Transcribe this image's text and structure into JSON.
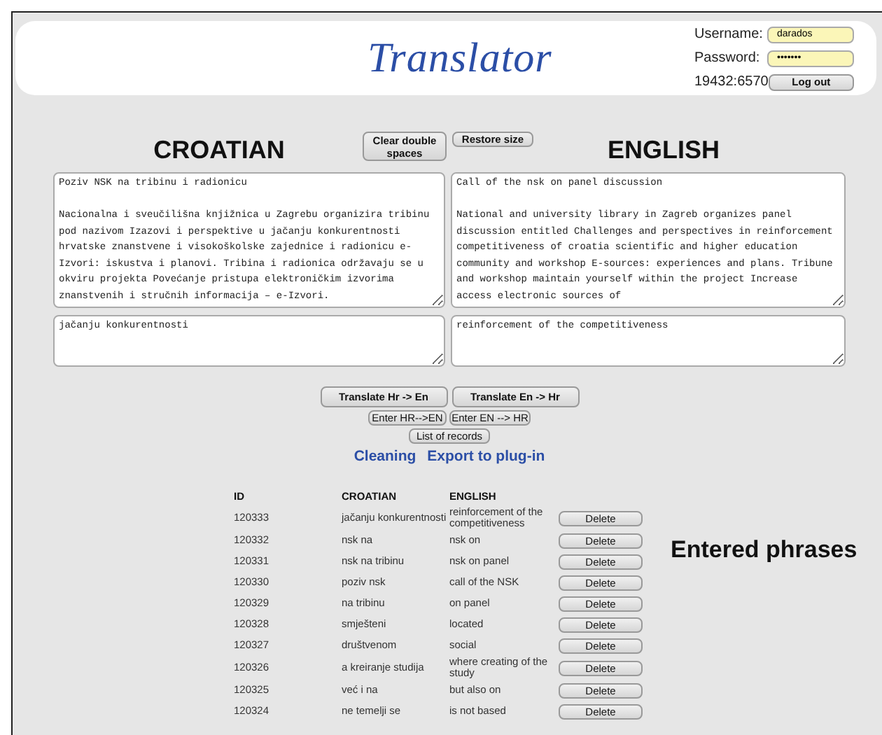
{
  "header": {
    "title": "Translator",
    "login": {
      "username_label": "Username:",
      "username": "darados",
      "password_label": "Password:",
      "password": "•••••••",
      "session": "19432:6570",
      "logout": "Log out"
    }
  },
  "languages": {
    "source_heading": "CROATIAN",
    "target_heading": "ENGLISH"
  },
  "tool_buttons": [
    "Clear double spaces",
    "Restore size"
  ],
  "source_text": "Poziv NSK na tribinu i radionicu\n\nNacionalna i sveučilišna knjižnica u Zagrebu organizira tribinu pod nazivom Izazovi i perspektive u jačanju konkurentnosti hrvatske znanstvene i visokoškolske zajednice i radionicu e-Izvori: iskustva i planovi. Tribina i radionica održavaju se u okviru projekta Povećanje pristupa elektroničkim izvorima znanstvenih i stručnih informacija – e-Izvori.",
  "target_text": "Call of the nsk on panel discussion\n\nNational and university library in Zagreb organizes panel discussion entitled Challenges and perspectives in reinforcement competitiveness of croatia scientific and higher education community and workshop E-sources: experiences and plans. Tribune and workshop maintain yourself within the project Increase access electronic sources of",
  "source_phrase": "jačanju konkurentnosti",
  "target_phrase": "reinforcement of the competitiveness",
  "translate_buttons": [
    "Translate Hr -> En",
    "Translate En -> Hr"
  ],
  "enter_buttons": [
    "Enter HR-->EN",
    "Enter EN --> HR"
  ],
  "list_button": "List of records",
  "links": [
    "Cleaning",
    "Export to plug-in"
  ],
  "records": {
    "heading": "Entered phrases",
    "columns": [
      "ID",
      "CROATIAN",
      "ENGLISH"
    ],
    "rows": [
      {
        "id": "120333",
        "croatian": "jačanju konkurentnosti",
        "english": "reinforcement of the competitiveness",
        "action": "Delete"
      },
      {
        "id": "120332",
        "croatian": "nsk na",
        "english": "nsk on",
        "action": "Delete"
      },
      {
        "id": "120331",
        "croatian": "nsk na tribinu",
        "english": "nsk on panel",
        "action": "Delete"
      },
      {
        "id": "120330",
        "croatian": "poziv nsk",
        "english": "call of the NSK",
        "action": "Delete"
      },
      {
        "id": "120329",
        "croatian": "na tribinu",
        "english": "on panel",
        "action": "Delete"
      },
      {
        "id": "120328",
        "croatian": "smješteni",
        "english": "located",
        "action": "Delete"
      },
      {
        "id": "120327",
        "croatian": "društvenom",
        "english": "social",
        "action": "Delete"
      },
      {
        "id": "120326",
        "croatian": "a kreiranje studija",
        "english": "where creating of the study",
        "action": "Delete"
      },
      {
        "id": "120325",
        "croatian": "već i na",
        "english": "but also on",
        "action": "Delete"
      },
      {
        "id": "120324",
        "croatian": "ne temelji se",
        "english": "is not based",
        "action": "Delete"
      }
    ]
  }
}
